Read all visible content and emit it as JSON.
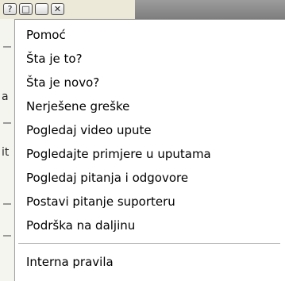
{
  "window": {
    "buttons": [
      "?",
      "□",
      "✕"
    ]
  },
  "sidebar_chars": [
    "a",
    "it"
  ],
  "menu": {
    "items": [
      "Pomoć",
      "Šta je to?",
      "Šta je novo?",
      "Nerješene greške",
      "Pogledaj video upute",
      "Pogledajte primjere u uputama",
      "Pogledaj pitanja i odgovore",
      "Postavi pitanje suporteru",
      "Podrška na daljinu"
    ],
    "footer_item": "Interna pravila"
  }
}
